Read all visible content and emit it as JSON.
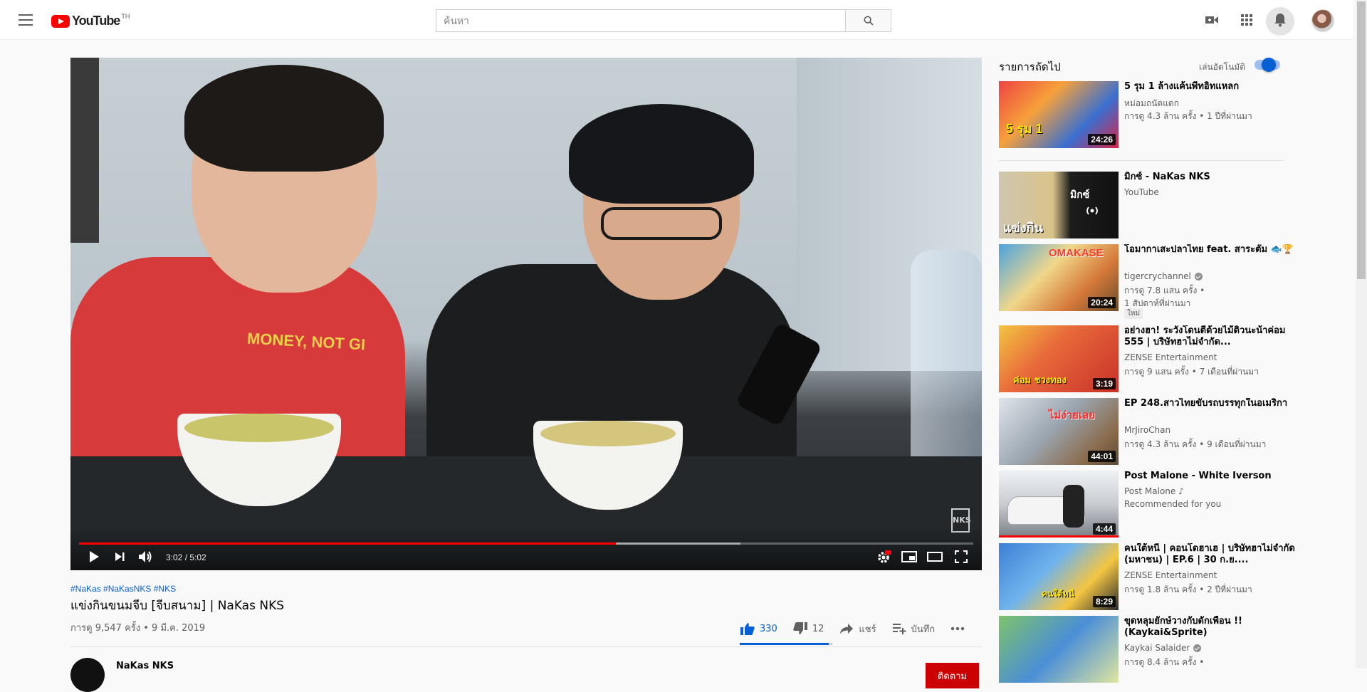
{
  "header": {
    "logo_text": "YouTube",
    "logo_country": "TH",
    "search_placeholder": "ค้นหา"
  },
  "player": {
    "time_current": "3:02",
    "time_total": "5:02",
    "time_display": "3:02 / 5:02",
    "progress_played": 0.6,
    "progress_buffered": 0.74,
    "shirt_text": "MONEY, NOT GI",
    "watermark": "NKS"
  },
  "video": {
    "tags": "#NaKas #NaKasNKS #NKS",
    "title": "แข่งกินขนมจีบ [จีบสนาม] | NaKas NKS",
    "meta": "การดู 9,547 ครั้ง • 9 มี.ค. 2019",
    "likes": "330",
    "dislikes": "12",
    "like_ratio": 0.965,
    "share_label": "แชร์",
    "save_label": "บันทึก",
    "channel_name": "NaKas NKS",
    "subscribe_label": "ติดตาม"
  },
  "sidebar": {
    "up_next": "รายการถัดไป",
    "autoplay_label": "เล่นอัตโนมัติ",
    "autoplay_on": true,
    "items": [
      {
        "title": "5 รุม 1 ล้างแค้นพี่ทอิทแหลก",
        "channel": "หม่อมถนัดแดก",
        "views": "การดู 4.3 ล้าน ครั้ง • 1 ปีที่ผ่านมา",
        "duration": "24:26",
        "verified": false,
        "thumb_text": "5 รุม 1"
      },
      {
        "title": "มิกซ์ - NaKas NKS",
        "channel": "YouTube",
        "views": "",
        "duration": "",
        "verified": false,
        "thumb_text": "แข่งกิน",
        "mix_label": "มิกซ์"
      },
      {
        "title": "โอมากาเสะปลาไทย feat. สาระตั้ม 🐟🏆",
        "channel": "tigercrychannel",
        "views": "การดู 7.8 แสน ครั้ง •",
        "views2": "1 สัปดาห์ที่ผ่านมา",
        "badge": "ใหม่",
        "duration": "20:24",
        "verified": true,
        "thumb_text": "OMAKASE"
      },
      {
        "title": "อย่างฮา! ระวังโดนตีด้วยไม้ดิวนะน้าค่อม 555 | บริษัทฮาไม่จำกัด...",
        "channel": "ZENSE Entertainment",
        "views": "การดู 9 แสน ครั้ง • 7 เดือนที่ผ่านมา",
        "duration": "3:19",
        "verified": false,
        "thumb_text": "ค่อม ชวงทอง"
      },
      {
        "title": "EP 248.สาวไทยขับรถบรรทุกในอเมริกา",
        "channel": "MrJiroChan",
        "views": "การดู 4.3 ล้าน ครั้ง • 9 เดือนที่ผ่านมา",
        "duration": "44:01",
        "verified": false,
        "thumb_text": "ไม่ง่ายเลย"
      },
      {
        "title": "Post Malone - White Iverson",
        "channel": "Post Malone ♪",
        "views": "Recommended for you",
        "duration": "4:44",
        "verified": false,
        "thumb_text": ""
      },
      {
        "title": "คนใต้หนี | คอนโดฮาเฮ | บริษัทฮาไม่จำกัด (มหาชน) | EP.6 | 30 ก.ย....",
        "channel": "ZENSE Entertainment",
        "views": "การดู 1.8 ล้าน ครั้ง • 2 ปีที่ผ่านมา",
        "duration": "8:29",
        "verified": false,
        "thumb_text": "คนใต้หนี"
      },
      {
        "title": "ขุดหลุมยักษ์วางกับดักเพื่อน !! (Kaykai&Sprite)",
        "channel": "Kaykai Salaider",
        "views": "การดู 8.4 ล้าน ครั้ง •",
        "duration": "",
        "verified": true,
        "thumb_text": ""
      }
    ]
  },
  "colors": {
    "brand_red": "#ff0000",
    "link_blue": "#065fd4",
    "progress_red": "#ff0000"
  }
}
